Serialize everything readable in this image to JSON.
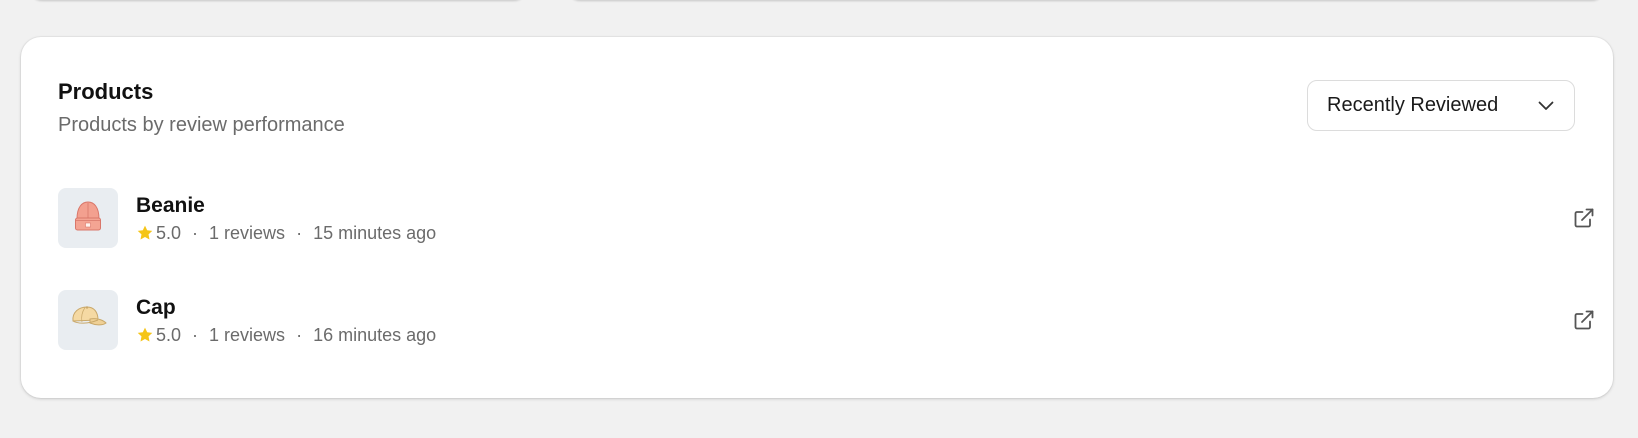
{
  "products_card": {
    "title": "Products",
    "subtitle": "Products by review performance",
    "sort": {
      "selected": "Recently Reviewed"
    },
    "items": [
      {
        "name": "Beanie",
        "rating": "5.0",
        "reviews": "1 reviews",
        "separator": "·",
        "time": "15 minutes ago",
        "image_icon": "beanie-icon"
      },
      {
        "name": "Cap",
        "rating": "5.0",
        "reviews": "1 reviews",
        "separator": "·",
        "time": "16 minutes ago",
        "image_icon": "cap-icon"
      }
    ]
  },
  "colors": {
    "page_background": "#f1f1f1",
    "card_background": "#ffffff",
    "star": "#f5c518",
    "muted_text": "#6b6b6b",
    "thumb_background": "#e9edf1"
  }
}
